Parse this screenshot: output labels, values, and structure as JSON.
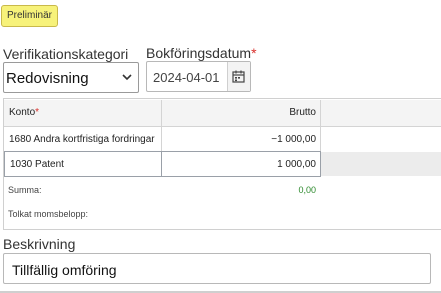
{
  "status_badge": "Preliminär",
  "category": {
    "label": "Verifikationskategori",
    "value": "Redovisning"
  },
  "booking_date": {
    "label": "Bokföringsdatum",
    "required_mark": "*",
    "value": "2024-04-01"
  },
  "table": {
    "columns": [
      {
        "label": "Konto",
        "required_mark": "*"
      },
      {
        "label": "Brutto"
      }
    ],
    "rows": [
      {
        "konto": "1680 Andra kortfristiga fordringar",
        "brutto": "−1 000,00"
      },
      {
        "konto": "1030 Patent",
        "brutto": "1 000,00"
      }
    ],
    "summa_label": "Summa:",
    "summa_value": "0,00",
    "moms_label": "Tolkat momsbelopp:"
  },
  "description": {
    "label": "Beskrivning",
    "value": "Tillfällig omföring"
  },
  "colors": {
    "badge": "#f7f27a",
    "sum_ok": "#2d8a2d",
    "required": "#d9302c"
  },
  "icons": {
    "select": "chevron-down-icon",
    "date": "calendar-icon"
  }
}
